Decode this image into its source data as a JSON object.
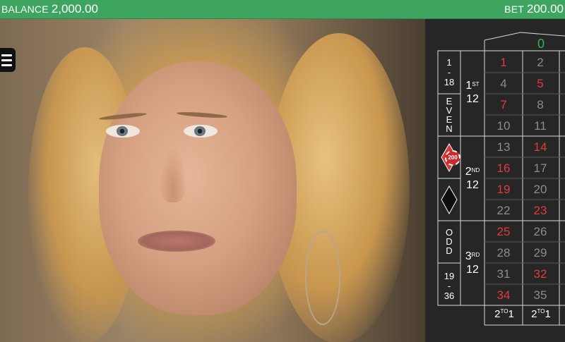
{
  "topbar": {
    "balance_label": "BALANCE",
    "balance_value": "2,000.00",
    "bet_label": "BET",
    "bet_value": "200.00"
  },
  "menu": {
    "icon": "hamburger-menu-icon"
  },
  "table": {
    "zero": "0",
    "rows": [
      {
        "a": "1",
        "b": "2"
      },
      {
        "a": "4",
        "b": "5"
      },
      {
        "a": "7",
        "b": "8"
      },
      {
        "a": "10",
        "b": "11"
      },
      {
        "a": "13",
        "b": "14"
      },
      {
        "a": "16",
        "b": "17"
      },
      {
        "a": "19",
        "b": "20"
      },
      {
        "a": "22",
        "b": "23"
      },
      {
        "a": "25",
        "b": "26"
      },
      {
        "a": "28",
        "b": "29"
      },
      {
        "a": "31",
        "b": "32"
      },
      {
        "a": "34",
        "b": "35"
      }
    ],
    "low_top": "1",
    "low_bottom": "18",
    "even": "EVEN",
    "odd": "ODD",
    "high_top": "19",
    "high_bottom": "36",
    "dozen1_num": "1",
    "dozen1_sup": "ST",
    "dozen2_num": "2",
    "dozen2_sup": "ND",
    "dozen3_num": "3",
    "dozen3_sup": "RD",
    "dozen_count": "12",
    "col_main": "2",
    "col_sup": "TO",
    "col_end": "1",
    "chip_value": "200",
    "colors": {
      "red": "#e23a3c",
      "grey": "#8c8c8c",
      "green": "#35b04a"
    }
  }
}
